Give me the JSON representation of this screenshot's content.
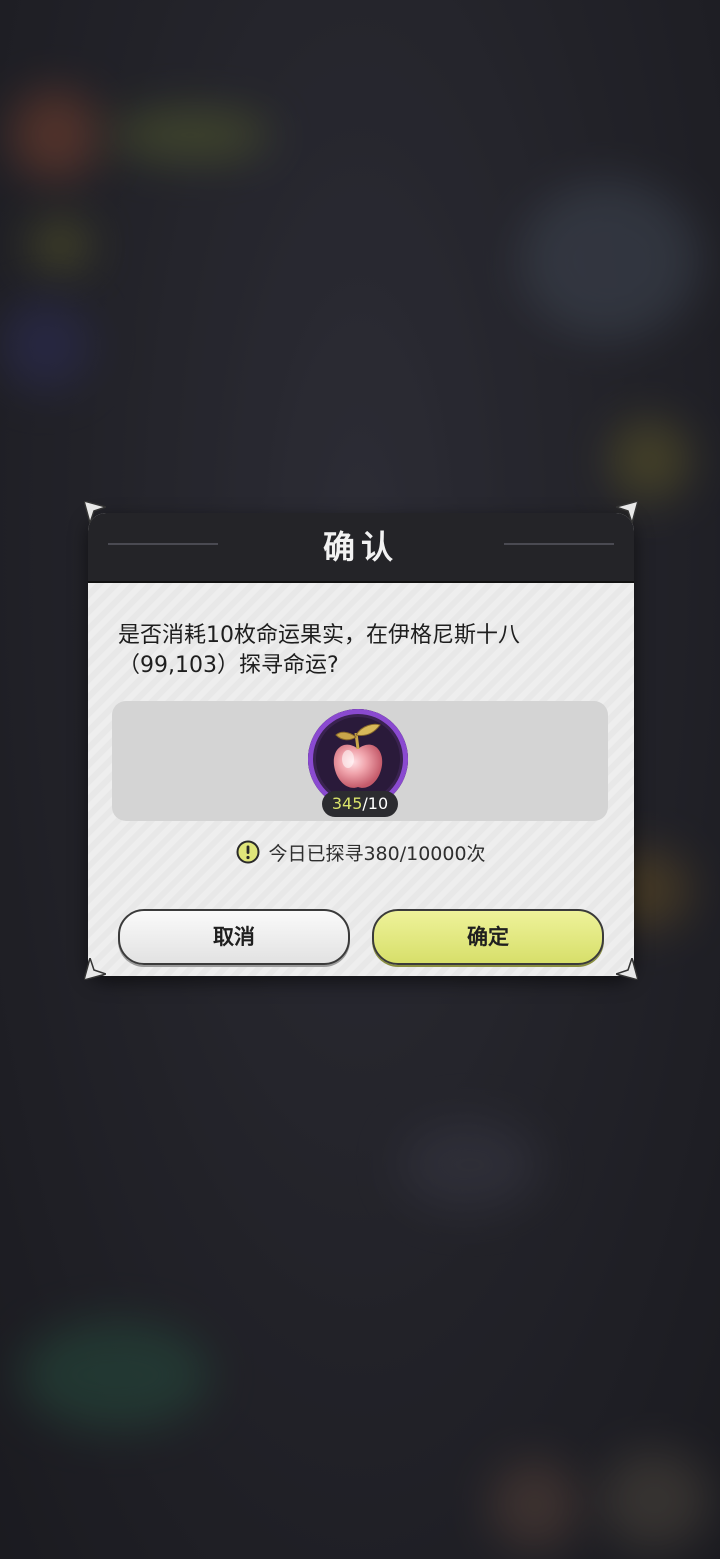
{
  "dialog": {
    "title": "确认",
    "message_line1": "是否消耗10枚命运果实，在伊格尼斯十八",
    "message_line2": "（99,103）探寻命运?",
    "item": {
      "icon": "fate-fruit-icon",
      "have": "345",
      "need": "/10"
    },
    "notice": "今日已探寻380/10000次",
    "cancel_label": "取消",
    "confirm_label": "确定"
  },
  "colors": {
    "confirm_button": "#dfe57a",
    "item_ring": "#8a4ad0",
    "count_highlight": "#d9e36a"
  }
}
